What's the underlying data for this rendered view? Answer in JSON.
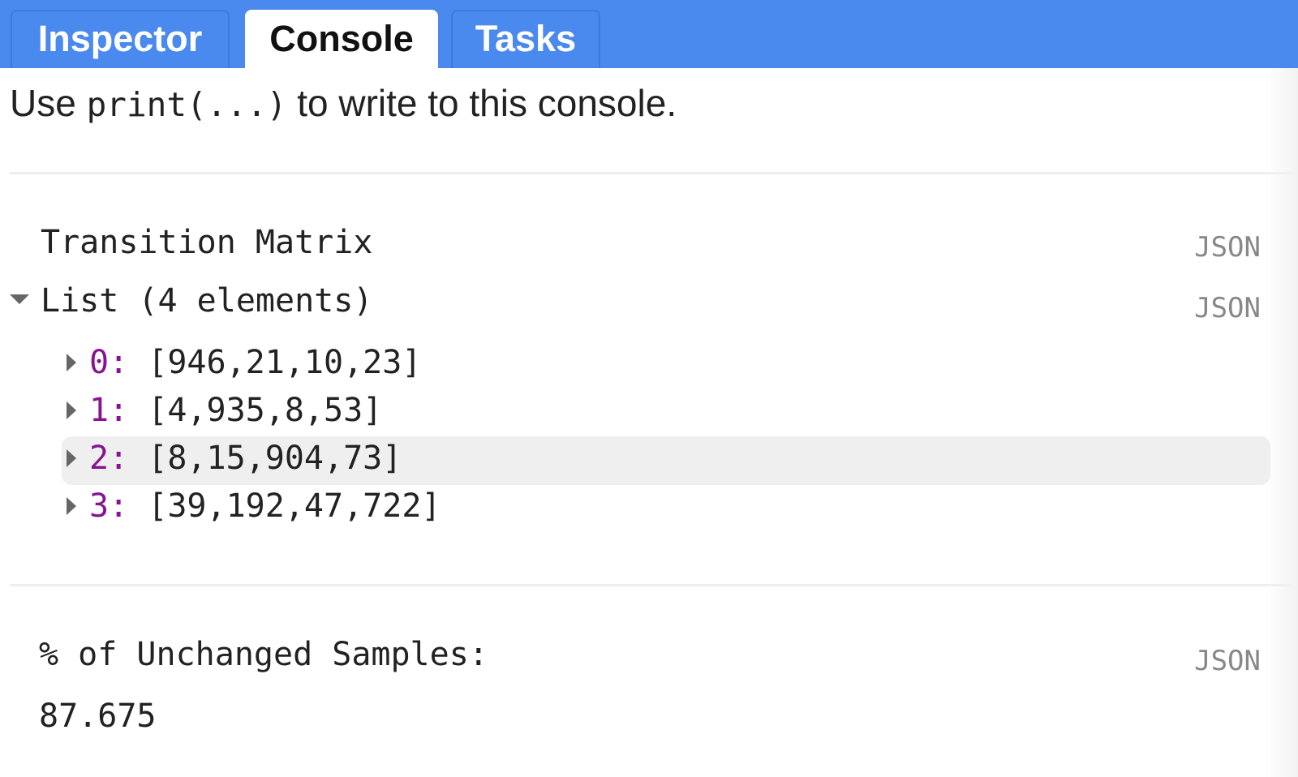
{
  "tabs": [
    {
      "label": "Inspector",
      "active": false
    },
    {
      "label": "Console",
      "active": true
    },
    {
      "label": "Tasks",
      "active": false
    }
  ],
  "console": {
    "hint_prefix": "Use ",
    "hint_code": "print(...)",
    "hint_suffix": " to write to this console.",
    "outputs": [
      {
        "title": "Transition Matrix",
        "json_label": "JSON",
        "list_header": "List (4 elements)",
        "list_json_label": "JSON",
        "items": [
          {
            "index": "0:",
            "value": "[946,21,10,23]"
          },
          {
            "index": "1:",
            "value": "[4,935,8,53]"
          },
          {
            "index": "2:",
            "value": "[8,15,904,73]"
          },
          {
            "index": "3:",
            "value": "[39,192,47,722]"
          }
        ]
      },
      {
        "title": "% of Unchanged Samples:",
        "json_label": "JSON",
        "value": "87.675"
      }
    ]
  },
  "colors": {
    "tabbar": "#4a89ee",
    "index": "#881391",
    "hover_row": "#efefef"
  }
}
